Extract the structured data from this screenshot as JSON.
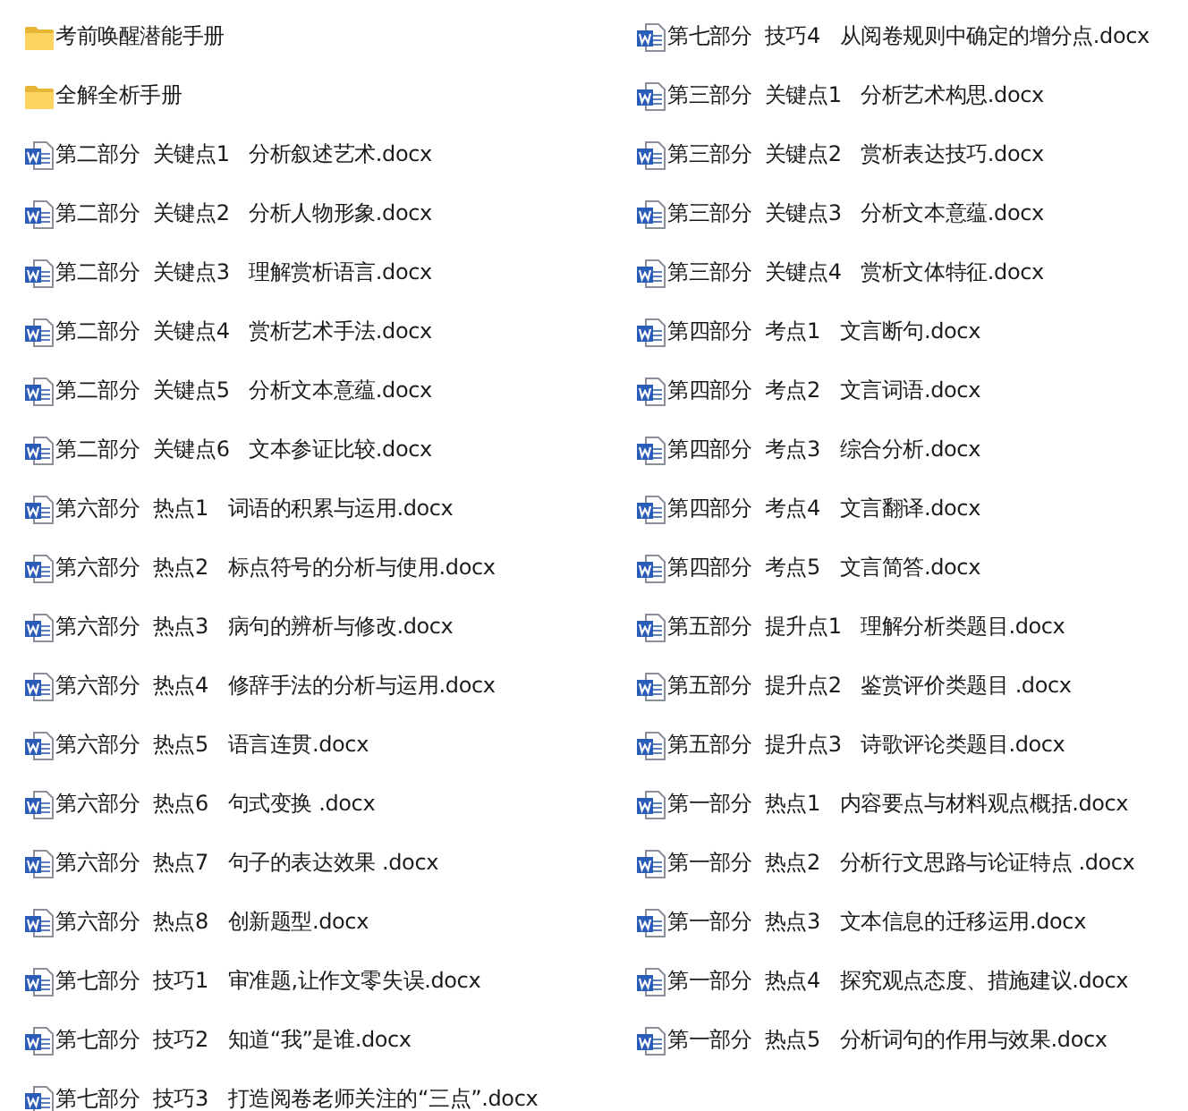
{
  "columns": [
    {
      "items": [
        {
          "kind": "folder",
          "name": "考前唤醒潜能手册"
        },
        {
          "kind": "folder",
          "name": "全解全析手册"
        },
        {
          "kind": "docx",
          "name": "第二部分  关键点1   分析叙述艺术.docx"
        },
        {
          "kind": "docx",
          "name": "第二部分  关键点2   分析人物形象.docx"
        },
        {
          "kind": "docx",
          "name": "第二部分  关键点3   理解赏析语言.docx"
        },
        {
          "kind": "docx",
          "name": "第二部分  关键点4   赏析艺术手法.docx"
        },
        {
          "kind": "docx",
          "name": "第二部分  关键点5   分析文本意蕴.docx"
        },
        {
          "kind": "docx",
          "name": "第二部分  关键点6   文本参证比较.docx"
        },
        {
          "kind": "docx",
          "name": "第六部分  热点1   词语的积累与运用.docx"
        },
        {
          "kind": "docx",
          "name": "第六部分  热点2   标点符号的分析与使用.docx"
        },
        {
          "kind": "docx",
          "name": "第六部分  热点3   病句的辨析与修改.docx"
        },
        {
          "kind": "docx",
          "name": "第六部分  热点4   修辞手法的分析与运用.docx"
        },
        {
          "kind": "docx",
          "name": "第六部分  热点5   语言连贯.docx"
        },
        {
          "kind": "docx",
          "name": "第六部分  热点6   句式变换 .docx"
        },
        {
          "kind": "docx",
          "name": "第六部分  热点7   句子的表达效果 .docx"
        },
        {
          "kind": "docx",
          "name": "第六部分  热点8   创新题型.docx"
        },
        {
          "kind": "docx",
          "name": "第七部分  技巧1   审准题,让作文零失误.docx"
        },
        {
          "kind": "docx",
          "name": "第七部分  技巧2   知道“我”是谁.docx"
        },
        {
          "kind": "docx",
          "name": "第七部分  技巧3   打造阅卷老师关注的“三点”.docx"
        }
      ]
    },
    {
      "items": [
        {
          "kind": "docx",
          "name": "第七部分  技巧4   从阅卷规则中确定的增分点.docx"
        },
        {
          "kind": "docx",
          "name": "第三部分  关键点1   分析艺术构思.docx"
        },
        {
          "kind": "docx",
          "name": "第三部分  关键点2   赏析表达技巧.docx"
        },
        {
          "kind": "docx",
          "name": "第三部分  关键点3   分析文本意蕴.docx"
        },
        {
          "kind": "docx",
          "name": "第三部分  关键点4   赏析文体特征.docx"
        },
        {
          "kind": "docx",
          "name": "第四部分  考点1   文言断句.docx"
        },
        {
          "kind": "docx",
          "name": "第四部分  考点2   文言词语.docx"
        },
        {
          "kind": "docx",
          "name": "第四部分  考点3   综合分析.docx"
        },
        {
          "kind": "docx",
          "name": "第四部分  考点4   文言翻译.docx"
        },
        {
          "kind": "docx",
          "name": "第四部分  考点5   文言简答.docx"
        },
        {
          "kind": "docx",
          "name": "第五部分  提升点1   理解分析类题目.docx"
        },
        {
          "kind": "docx",
          "name": "第五部分  提升点2   鉴赏评价类题目 .docx"
        },
        {
          "kind": "docx",
          "name": "第五部分  提升点3   诗歌评论类题目.docx"
        },
        {
          "kind": "docx",
          "name": "第一部分  热点1   内容要点与材料观点概括.docx"
        },
        {
          "kind": "docx",
          "name": "第一部分  热点2   分析行文思路与论证特点 .docx"
        },
        {
          "kind": "docx",
          "name": "第一部分  热点3   文本信息的迁移运用.docx"
        },
        {
          "kind": "docx",
          "name": "第一部分  热点4   探究观点态度、措施建议.docx"
        },
        {
          "kind": "docx",
          "name": "第一部分  热点5   分析词句的作用与效果.docx"
        }
      ]
    }
  ]
}
